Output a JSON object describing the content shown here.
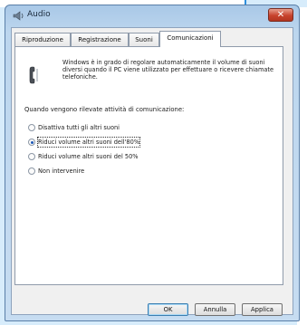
{
  "window": {
    "title": "Audio",
    "close_glyph": "✕"
  },
  "tabs": [
    {
      "label": "Riproduzione",
      "active": false
    },
    {
      "label": "Registrazione",
      "active": false
    },
    {
      "label": "Suoni",
      "active": false
    },
    {
      "label": "Comunicazioni",
      "active": true
    }
  ],
  "panel": {
    "description": "Windows è in grado di regolare automaticamente il volume di suoni diversi quando il PC viene utilizzato per effettuare o ricevere chiamate telefoniche.",
    "question": "Quando vengono rilevate attività di comunicazione:",
    "options": [
      {
        "label": "Disattiva tutti gli altri suoni",
        "selected": false
      },
      {
        "label": "Riduci volume altri suoni dell'80%",
        "selected": true
      },
      {
        "label": "Riduci volume altri suoni del 50%",
        "selected": false
      },
      {
        "label": "Non intervenire",
        "selected": false
      }
    ]
  },
  "buttons": {
    "ok": "OK",
    "cancel": "Annulla",
    "apply": "Applica"
  },
  "icons": {
    "title": "speaker-icon",
    "panel": "phone-icon"
  },
  "colors": {
    "background_accent": "#d7ecfb",
    "close_button": "#c8432d",
    "radio_dot": "#1b58b8"
  }
}
